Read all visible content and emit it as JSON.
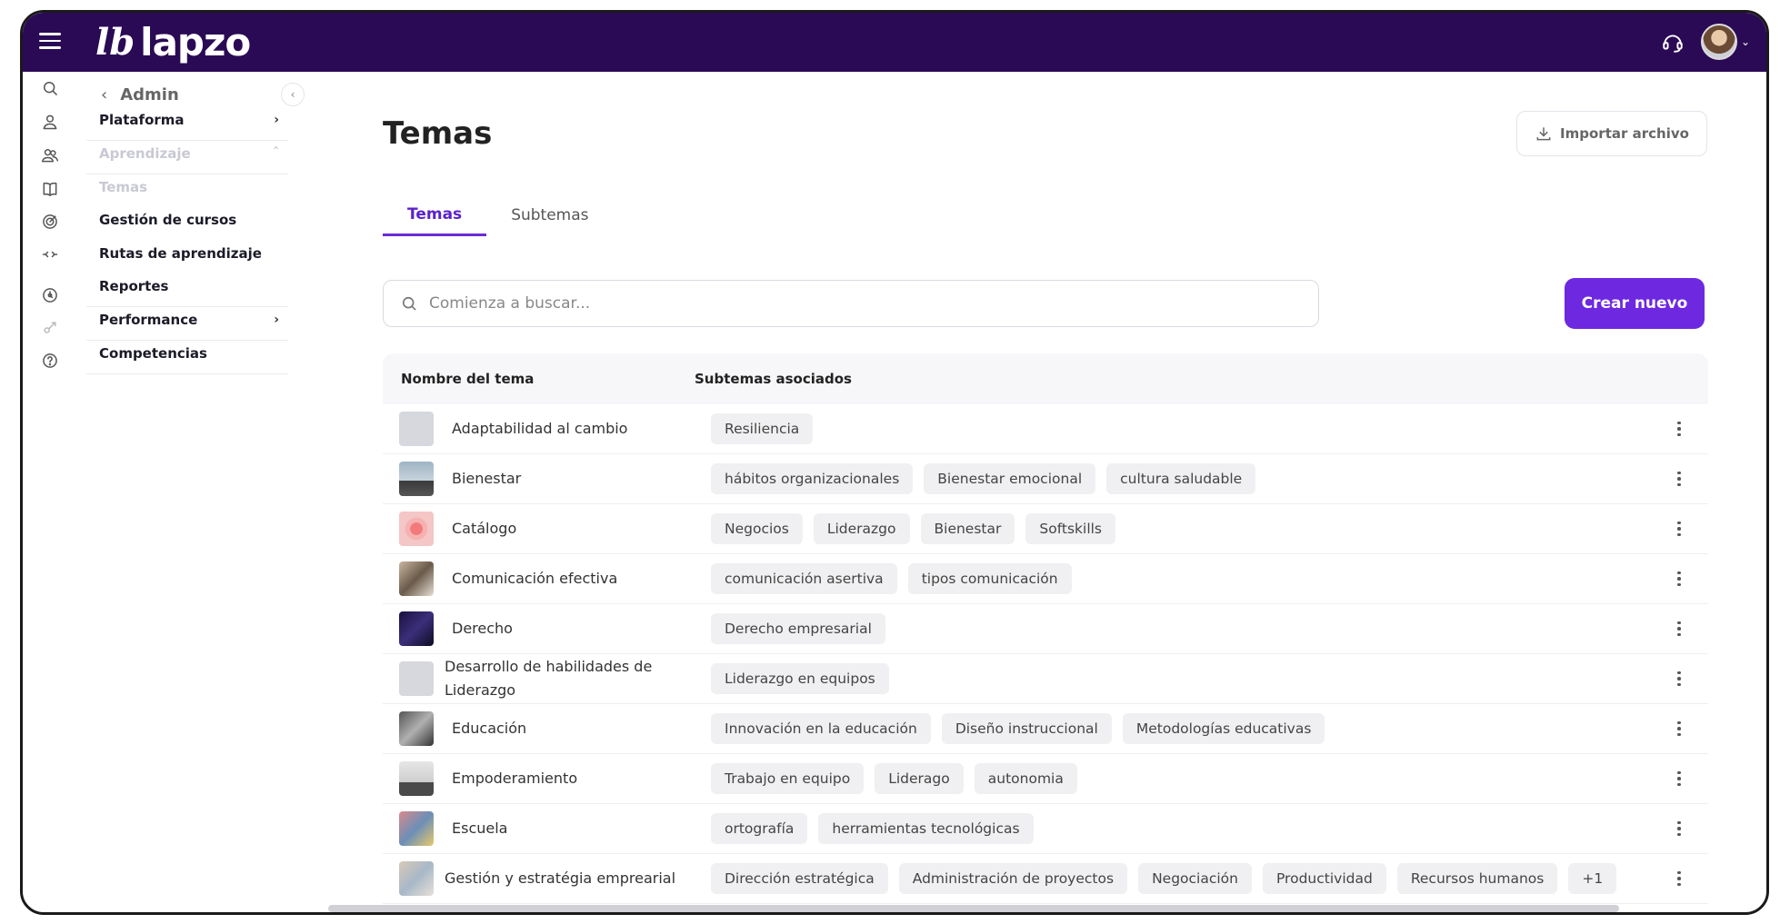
{
  "app": {
    "logo_mark": "lb",
    "logo_text": "lapzo"
  },
  "nav": {
    "title": "Admin",
    "back_glyph": "‹",
    "collapse_glyph": "‹",
    "items": [
      {
        "label": "Plataforma",
        "chev": "›"
      },
      {
        "label": "Aprendizaje",
        "chev": "ˆ"
      },
      {
        "label": "Temas"
      },
      {
        "label": "Gestión de cursos"
      },
      {
        "label": "Rutas de aprendizaje"
      },
      {
        "label": "Reportes"
      },
      {
        "label": "Performance",
        "chev": "›"
      },
      {
        "label": "Competencias"
      }
    ]
  },
  "page": {
    "title": "Temas",
    "import_label": "Importar archivo",
    "tabs": [
      "Temas",
      "Subtemas"
    ],
    "search_placeholder": "Comienza a buscar...",
    "create_label": "Crear nuevo"
  },
  "table": {
    "headers": [
      "Nombre del tema",
      "Subtemas asociados"
    ],
    "rows": [
      {
        "name": "Adaptabilidad al cambio",
        "chips": [
          "Resiliencia"
        ]
      },
      {
        "name": "Bienestar",
        "chips": [
          "hábitos organizacionales",
          "Bienestar emocional",
          "cultura saludable"
        ]
      },
      {
        "name": "Catálogo",
        "chips": [
          "Negocios",
          "Liderazgo",
          "Bienestar",
          "Softskills"
        ]
      },
      {
        "name": "Comunicación efectiva",
        "chips": [
          "comunicación asertiva",
          "tipos comunicación"
        ]
      },
      {
        "name": "Derecho",
        "chips": [
          "Derecho empresarial"
        ]
      },
      {
        "name": "Desarrollo de habilidades de Liderazgo",
        "chips": [
          "Liderazgo en equipos"
        ]
      },
      {
        "name": "Educación",
        "chips": [
          "Innovación en la educación",
          "Diseño instruccional",
          "Metodologías educativas"
        ]
      },
      {
        "name": "Empoderamiento",
        "chips": [
          "Trabajo en equipo",
          "Liderago",
          "autonomia"
        ]
      },
      {
        "name": "Escuela",
        "chips": [
          "ortografía",
          "herramientas tecnológicas"
        ]
      },
      {
        "name": "Gestión y estratégia emprearial",
        "chips": [
          "Dirección estratégica",
          "Administración de proyectos",
          "Negociación",
          "Productividad",
          "Recursos humanos",
          "+1"
        ]
      }
    ]
  },
  "colors": {
    "topbar": "#2a0a55",
    "accent": "#6d28e0",
    "chip_bg": "#f0f0f2"
  }
}
